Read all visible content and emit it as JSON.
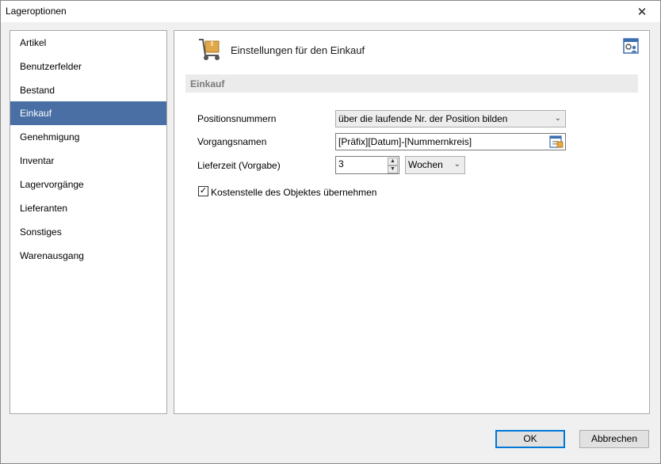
{
  "window": {
    "title": "Lageroptionen",
    "close_glyph": "✕"
  },
  "sidebar": {
    "items": [
      {
        "label": "Artikel"
      },
      {
        "label": "Benutzerfelder"
      },
      {
        "label": "Bestand"
      },
      {
        "label": "Einkauf",
        "selected": true
      },
      {
        "label": "Genehmigung"
      },
      {
        "label": "Inventar"
      },
      {
        "label": "Lagervorgänge"
      },
      {
        "label": "Lieferanten"
      },
      {
        "label": "Sonstiges"
      },
      {
        "label": "Warenausgang"
      }
    ],
    "selected_color": "#4a6fa5"
  },
  "content": {
    "header_icon": "hand-truck-icon",
    "header_title": "Einstellungen für den Einkauf",
    "settings_icon": "settings-user-icon",
    "section_title": "Einkauf",
    "fields": {
      "positionsnummern": {
        "label": "Positionsnummern",
        "value": "über die laufende Nr. der Position bilden"
      },
      "vorgangsnamen": {
        "label": "Vorgangsnamen",
        "value": "[Präfix][Datum]-[Nummernkreis]",
        "button_icon": "edit-template-icon"
      },
      "lieferzeit": {
        "label": "Lieferzeit (Vorgabe)",
        "value": "3",
        "unit": "Wochen"
      }
    },
    "checkbox": {
      "label": "Kostenstelle des Objektes übernehmen",
      "checked": true,
      "check_glyph": "✓"
    }
  },
  "footer": {
    "ok_label": "OK",
    "cancel_label": "Abbrechen"
  }
}
